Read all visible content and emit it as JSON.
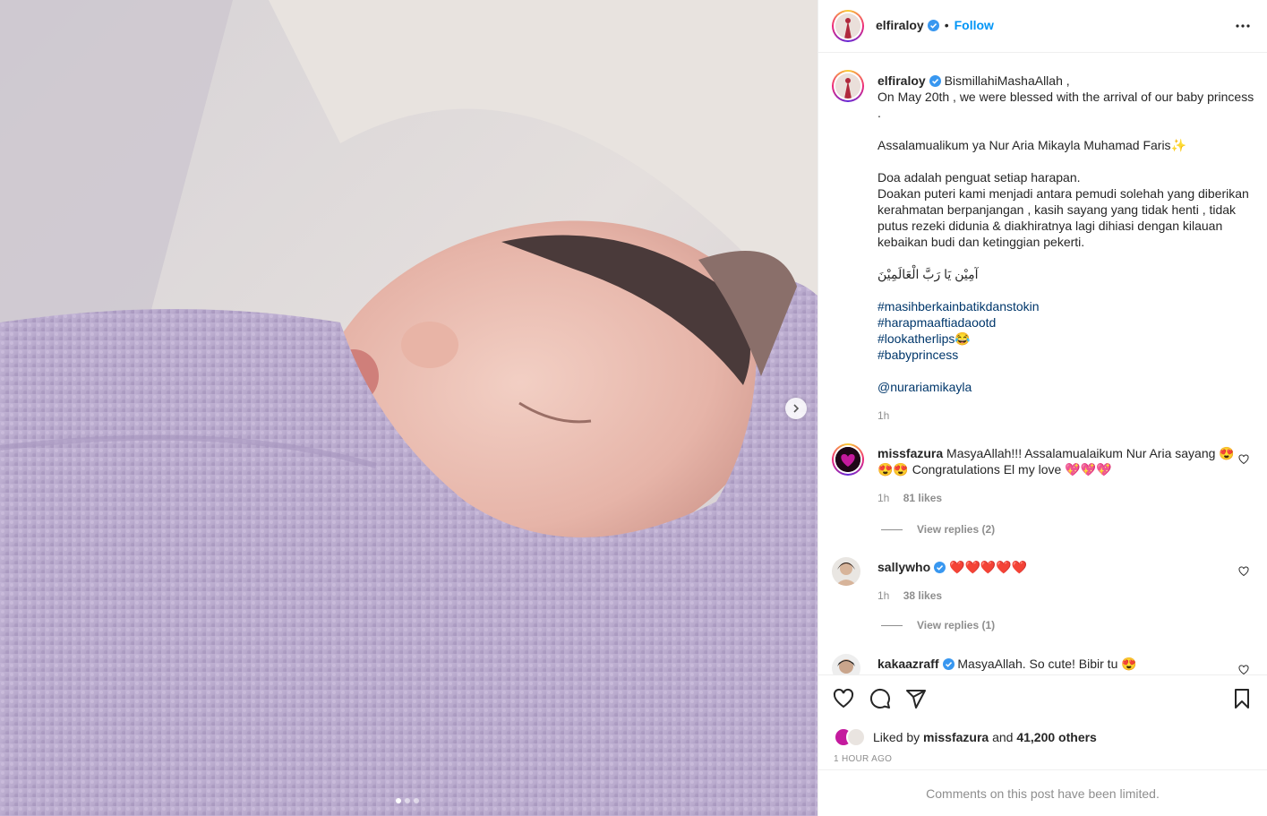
{
  "post": {
    "username": "elfiraloy",
    "follow_label": "Follow",
    "dot": "•"
  },
  "caption": {
    "username": "elfiraloy",
    "title": "BismillahiMashaAllah ,",
    "line1": "On May 20th , we were blessed with the arrival of our baby princess",
    "line1b": ".",
    "line2": "Assalamualikum ya Nur Aria Mikayla Muhamad Faris✨",
    "line3": "Doa adalah penguat setiap harapan.",
    "line4": "Doakan puteri kami menjadi antara pemudi solehah yang diberikan kerahmatan berpanjangan , kasih sayang yang tidak henti , tidak putus rezeki didunia & diakhiratnya lagi dihiasi dengan kilauan kebaikan budi dan ketinggian pekerti.",
    "arabic": "آمِيْن يَا رَبَّ الْعَالَمِيْنَ",
    "hashtags": [
      "#masihberkainbatikdanstokin",
      "#harapmaaftiadaootd",
      "#lookatherlips😂",
      "#babyprincess"
    ],
    "mention": "@nurariamikayla",
    "time": "1h"
  },
  "comments": [
    {
      "username": "missfazura",
      "text": "MasyaAllah!!! Assalamualaikum Nur Aria sayang 😍😍😍 Congratulations El my love 💖💖💖",
      "time": "1h",
      "likes": "81 likes",
      "replies": "View replies (2)"
    },
    {
      "username": "sallywho",
      "text": "❤️❤️❤️❤️❤️",
      "time": "1h",
      "likes": "38 likes",
      "replies": "View replies (1)"
    },
    {
      "username": "kakaazraff",
      "text": "MasyaAllah. So cute! Bibir tu 😍"
    }
  ],
  "likes": {
    "prefix": "Liked by",
    "user": "missfazura",
    "and": "and",
    "others": "41,200 others"
  },
  "timestamp": "1 HOUR AGO",
  "footer": "Comments on this post have been limited.",
  "carousel": {
    "current": 1,
    "total": 3
  },
  "colors": {
    "accent": "#0095f6",
    "hashtag": "#00376b",
    "verified": "#3897f0",
    "muted": "#8e8e8e"
  }
}
